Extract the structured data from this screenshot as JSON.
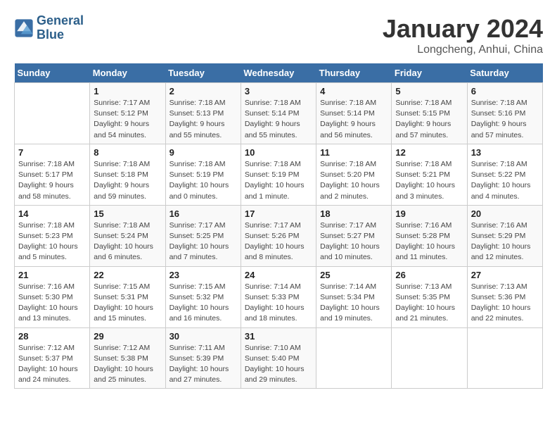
{
  "header": {
    "logo_line1": "General",
    "logo_line2": "Blue",
    "month_title": "January 2024",
    "subtitle": "Longcheng, Anhui, China"
  },
  "days_of_week": [
    "Sunday",
    "Monday",
    "Tuesday",
    "Wednesday",
    "Thursday",
    "Friday",
    "Saturday"
  ],
  "weeks": [
    [
      {
        "day": "",
        "info": ""
      },
      {
        "day": "1",
        "info": "Sunrise: 7:17 AM\nSunset: 5:12 PM\nDaylight: 9 hours\nand 54 minutes."
      },
      {
        "day": "2",
        "info": "Sunrise: 7:18 AM\nSunset: 5:13 PM\nDaylight: 9 hours\nand 55 minutes."
      },
      {
        "day": "3",
        "info": "Sunrise: 7:18 AM\nSunset: 5:14 PM\nDaylight: 9 hours\nand 55 minutes."
      },
      {
        "day": "4",
        "info": "Sunrise: 7:18 AM\nSunset: 5:14 PM\nDaylight: 9 hours\nand 56 minutes."
      },
      {
        "day": "5",
        "info": "Sunrise: 7:18 AM\nSunset: 5:15 PM\nDaylight: 9 hours\nand 57 minutes."
      },
      {
        "day": "6",
        "info": "Sunrise: 7:18 AM\nSunset: 5:16 PM\nDaylight: 9 hours\nand 57 minutes."
      }
    ],
    [
      {
        "day": "7",
        "info": "Sunrise: 7:18 AM\nSunset: 5:17 PM\nDaylight: 9 hours\nand 58 minutes."
      },
      {
        "day": "8",
        "info": "Sunrise: 7:18 AM\nSunset: 5:18 PM\nDaylight: 9 hours\nand 59 minutes."
      },
      {
        "day": "9",
        "info": "Sunrise: 7:18 AM\nSunset: 5:19 PM\nDaylight: 10 hours\nand 0 minutes."
      },
      {
        "day": "10",
        "info": "Sunrise: 7:18 AM\nSunset: 5:19 PM\nDaylight: 10 hours\nand 1 minute."
      },
      {
        "day": "11",
        "info": "Sunrise: 7:18 AM\nSunset: 5:20 PM\nDaylight: 10 hours\nand 2 minutes."
      },
      {
        "day": "12",
        "info": "Sunrise: 7:18 AM\nSunset: 5:21 PM\nDaylight: 10 hours\nand 3 minutes."
      },
      {
        "day": "13",
        "info": "Sunrise: 7:18 AM\nSunset: 5:22 PM\nDaylight: 10 hours\nand 4 minutes."
      }
    ],
    [
      {
        "day": "14",
        "info": "Sunrise: 7:18 AM\nSunset: 5:23 PM\nDaylight: 10 hours\nand 5 minutes."
      },
      {
        "day": "15",
        "info": "Sunrise: 7:18 AM\nSunset: 5:24 PM\nDaylight: 10 hours\nand 6 minutes."
      },
      {
        "day": "16",
        "info": "Sunrise: 7:17 AM\nSunset: 5:25 PM\nDaylight: 10 hours\nand 7 minutes."
      },
      {
        "day": "17",
        "info": "Sunrise: 7:17 AM\nSunset: 5:26 PM\nDaylight: 10 hours\nand 8 minutes."
      },
      {
        "day": "18",
        "info": "Sunrise: 7:17 AM\nSunset: 5:27 PM\nDaylight: 10 hours\nand 10 minutes."
      },
      {
        "day": "19",
        "info": "Sunrise: 7:16 AM\nSunset: 5:28 PM\nDaylight: 10 hours\nand 11 minutes."
      },
      {
        "day": "20",
        "info": "Sunrise: 7:16 AM\nSunset: 5:29 PM\nDaylight: 10 hours\nand 12 minutes."
      }
    ],
    [
      {
        "day": "21",
        "info": "Sunrise: 7:16 AM\nSunset: 5:30 PM\nDaylight: 10 hours\nand 13 minutes."
      },
      {
        "day": "22",
        "info": "Sunrise: 7:15 AM\nSunset: 5:31 PM\nDaylight: 10 hours\nand 15 minutes."
      },
      {
        "day": "23",
        "info": "Sunrise: 7:15 AM\nSunset: 5:32 PM\nDaylight: 10 hours\nand 16 minutes."
      },
      {
        "day": "24",
        "info": "Sunrise: 7:14 AM\nSunset: 5:33 PM\nDaylight: 10 hours\nand 18 minutes."
      },
      {
        "day": "25",
        "info": "Sunrise: 7:14 AM\nSunset: 5:34 PM\nDaylight: 10 hours\nand 19 minutes."
      },
      {
        "day": "26",
        "info": "Sunrise: 7:13 AM\nSunset: 5:35 PM\nDaylight: 10 hours\nand 21 minutes."
      },
      {
        "day": "27",
        "info": "Sunrise: 7:13 AM\nSunset: 5:36 PM\nDaylight: 10 hours\nand 22 minutes."
      }
    ],
    [
      {
        "day": "28",
        "info": "Sunrise: 7:12 AM\nSunset: 5:37 PM\nDaylight: 10 hours\nand 24 minutes."
      },
      {
        "day": "29",
        "info": "Sunrise: 7:12 AM\nSunset: 5:38 PM\nDaylight: 10 hours\nand 25 minutes."
      },
      {
        "day": "30",
        "info": "Sunrise: 7:11 AM\nSunset: 5:39 PM\nDaylight: 10 hours\nand 27 minutes."
      },
      {
        "day": "31",
        "info": "Sunrise: 7:10 AM\nSunset: 5:40 PM\nDaylight: 10 hours\nand 29 minutes."
      },
      {
        "day": "",
        "info": ""
      },
      {
        "day": "",
        "info": ""
      },
      {
        "day": "",
        "info": ""
      }
    ]
  ]
}
